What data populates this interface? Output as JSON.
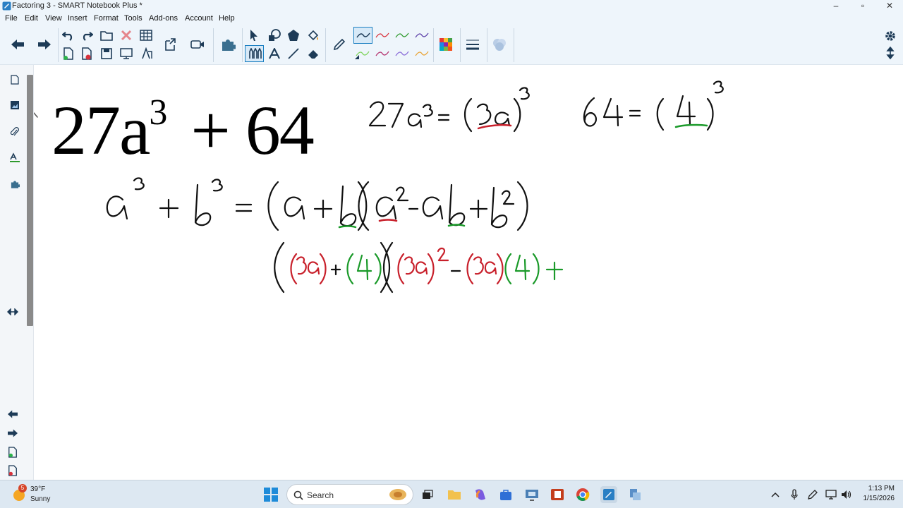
{
  "window": {
    "title": "Factoring 3 - SMART Notebook Plus *",
    "controls": {
      "minimize": "–",
      "restore": "▫",
      "close": "✕"
    }
  },
  "menu": [
    "File",
    "Edit",
    "View",
    "Insert",
    "Format",
    "Tools",
    "Add-ons",
    "Account",
    "Help"
  ],
  "canvas": {
    "typed_expression": {
      "coef": "27a",
      "exp": "3",
      "rest": "+ 64"
    },
    "handwriting": {
      "line1_left": "27a³ = (3a)³",
      "line1_right": "64 = (4)³",
      "formula": "a³ + b³ = (a + b)(a² − ab + b²)",
      "substitution": "((3a) + (4))((3a)² − (3a)(4) +"
    },
    "colors": {
      "red": "#c8202b",
      "green": "#1b9a2a",
      "ink": "#111111"
    }
  },
  "taskbar": {
    "weather": {
      "badge": "5",
      "temp": "39°F",
      "condition": "Sunny"
    },
    "search_label": "Search",
    "time": "1:13 PM",
    "date": "1/15/2026"
  },
  "accent": "#1a7fc1"
}
